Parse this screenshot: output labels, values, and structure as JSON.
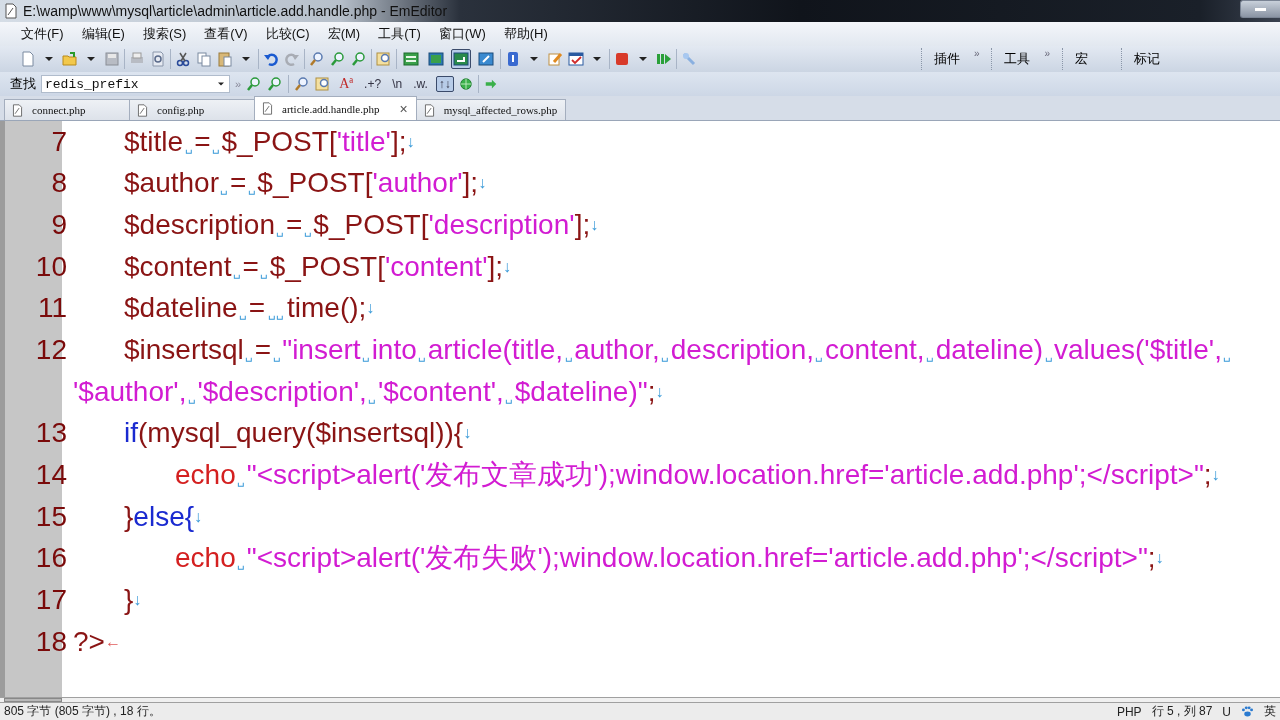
{
  "window": {
    "title": "E:\\wamp\\www\\mysql\\article\\admin\\article.add.handle.php - EmEditor"
  },
  "menu": [
    {
      "label": "文件(F)"
    },
    {
      "label": "编辑(E)"
    },
    {
      "label": "搜索(S)"
    },
    {
      "label": "查看(V)"
    },
    {
      "label": "比较(C)"
    },
    {
      "label": "宏(M)"
    },
    {
      "label": "工具(T)"
    },
    {
      "label": "窗口(W)"
    },
    {
      "label": "帮助(H)"
    }
  ],
  "toolbar": {
    "view_buttons": [
      {
        "selected": false
      },
      {
        "selected": false
      },
      {
        "selected": true
      },
      {
        "selected": false
      }
    ],
    "panels": [
      {
        "label": "插件",
        "more": "»"
      },
      {
        "label": "工具",
        "more": "»"
      },
      {
        "label": "宏"
      },
      {
        "label": "标记"
      }
    ]
  },
  "find_bar": {
    "label": "查找",
    "query": "redis_prefix",
    "more": "»",
    "options": [
      {
        "text": "Aª",
        "pressed": false
      },
      {
        "text": ".+?",
        "pressed": false
      },
      {
        "text": "\\n",
        "pressed": false
      },
      {
        "text": ".w.",
        "pressed": false
      },
      {
        "text": "↑↓",
        "pressed": true
      }
    ]
  },
  "tabs": [
    {
      "label": "connect.php",
      "selected": false
    },
    {
      "label": "config.php",
      "selected": false
    },
    {
      "label": "article.add.handle.php",
      "selected": true,
      "close": "×"
    },
    {
      "label": "mysql_affected_rows.php",
      "selected": false
    }
  ],
  "editor": {
    "lines": [
      {
        "number": "7",
        "rows": [
          {
            "tokens": [
              {
                "kind": "tab"
              },
              {
                "kind": "var",
                "text": "$title"
              },
              {
                "kind": "space",
                "text": "␣"
              },
              {
                "kind": "var",
                "text": "="
              },
              {
                "kind": "space",
                "text": "␣"
              },
              {
                "kind": "var",
                "text": "$_POST["
              },
              {
                "kind": "string",
                "text": "'title'"
              },
              {
                "kind": "var",
                "text": "];"
              },
              {
                "kind": "eol",
                "text": "↓"
              }
            ]
          }
        ]
      },
      {
        "number": "8",
        "rows": [
          {
            "tokens": [
              {
                "kind": "tab"
              },
              {
                "kind": "var",
                "text": "$author"
              },
              {
                "kind": "space",
                "text": "␣"
              },
              {
                "kind": "var",
                "text": "="
              },
              {
                "kind": "space",
                "text": "␣"
              },
              {
                "kind": "var",
                "text": "$_POST["
              },
              {
                "kind": "string",
                "text": "'author'"
              },
              {
                "kind": "var",
                "text": "];"
              },
              {
                "kind": "eol",
                "text": "↓"
              }
            ]
          }
        ]
      },
      {
        "number": "9",
        "rows": [
          {
            "tokens": [
              {
                "kind": "tab"
              },
              {
                "kind": "var",
                "text": "$description"
              },
              {
                "kind": "space",
                "text": "␣"
              },
              {
                "kind": "var",
                "text": "="
              },
              {
                "kind": "space",
                "text": "␣"
              },
              {
                "kind": "var",
                "text": "$_POST["
              },
              {
                "kind": "string",
                "text": "'description'"
              },
              {
                "kind": "var",
                "text": "];"
              },
              {
                "kind": "eol",
                "text": "↓"
              }
            ]
          }
        ]
      },
      {
        "number": "10",
        "rows": [
          {
            "tokens": [
              {
                "kind": "tab"
              },
              {
                "kind": "var",
                "text": "$content"
              },
              {
                "kind": "space",
                "text": "␣"
              },
              {
                "kind": "var",
                "text": "="
              },
              {
                "kind": "space",
                "text": "␣"
              },
              {
                "kind": "var",
                "text": "$_POST["
              },
              {
                "kind": "string",
                "text": "'content'"
              },
              {
                "kind": "var",
                "text": "];"
              },
              {
                "kind": "eol",
                "text": "↓"
              }
            ]
          }
        ]
      },
      {
        "number": "11",
        "rows": [
          {
            "tokens": [
              {
                "kind": "tab"
              },
              {
                "kind": "var",
                "text": "$dateline"
              },
              {
                "kind": "space",
                "text": "␣"
              },
              {
                "kind": "var",
                "text": "="
              },
              {
                "kind": "space",
                "text": "␣␣"
              },
              {
                "kind": "var",
                "text": "time();"
              },
              {
                "kind": "eol",
                "text": "↓"
              }
            ]
          }
        ]
      },
      {
        "number": "12",
        "rows": [
          {
            "tokens": [
              {
                "kind": "tab"
              },
              {
                "kind": "var",
                "text": "$insertsql"
              },
              {
                "kind": "space",
                "text": "␣"
              },
              {
                "kind": "var",
                "text": "="
              },
              {
                "kind": "space",
                "text": "␣"
              },
              {
                "kind": "string",
                "text": "\"insert"
              },
              {
                "kind": "space",
                "text": "␣"
              },
              {
                "kind": "string",
                "text": "into"
              },
              {
                "kind": "space",
                "text": "␣"
              },
              {
                "kind": "string",
                "text": "article(title,"
              },
              {
                "kind": "space",
                "text": "␣"
              },
              {
                "kind": "string",
                "text": "author,"
              },
              {
                "kind": "space",
                "text": "␣"
              },
              {
                "kind": "string",
                "text": "description,"
              },
              {
                "kind": "space",
                "text": "␣"
              },
              {
                "kind": "string",
                "text": "content,"
              },
              {
                "kind": "space",
                "text": "␣"
              },
              {
                "kind": "string",
                "text": "dateline)"
              },
              {
                "kind": "space",
                "text": "␣"
              },
              {
                "kind": "string",
                "text": "values('$title',"
              },
              {
                "kind": "space",
                "text": "␣"
              }
            ]
          },
          {
            "tokens": [
              {
                "kind": "string",
                "text": "'$author',"
              },
              {
                "kind": "space",
                "text": "␣"
              },
              {
                "kind": "string",
                "text": "'$description',"
              },
              {
                "kind": "space",
                "text": "␣"
              },
              {
                "kind": "string",
                "text": "'$content',"
              },
              {
                "kind": "space",
                "text": "␣"
              },
              {
                "kind": "string",
                "text": "$dateline)\""
              },
              {
                "kind": "var",
                "text": ";"
              },
              {
                "kind": "eol",
                "text": "↓"
              }
            ]
          }
        ]
      },
      {
        "number": "13",
        "rows": [
          {
            "tokens": [
              {
                "kind": "tab"
              },
              {
                "kind": "keyword",
                "text": "if"
              },
              {
                "kind": "var",
                "text": "(mysql_query($insertsql)){"
              },
              {
                "kind": "eol",
                "text": "↓"
              }
            ]
          }
        ]
      },
      {
        "number": "14",
        "rows": [
          {
            "tokens": [
              {
                "kind": "tab"
              },
              {
                "kind": "tab"
              },
              {
                "kind": "builtin",
                "text": "echo"
              },
              {
                "kind": "space",
                "text": "␣"
              },
              {
                "kind": "string",
                "text": "\"<script>alert('发布文章成功');window.location.href='article.add.php';</script>\""
              },
              {
                "kind": "var",
                "text": ";"
              },
              {
                "kind": "eol",
                "text": "↓"
              }
            ]
          }
        ]
      },
      {
        "number": "15",
        "rows": [
          {
            "tokens": [
              {
                "kind": "tab"
              },
              {
                "kind": "var",
                "text": "}"
              },
              {
                "kind": "keyword",
                "text": "else{"
              },
              {
                "kind": "eol",
                "text": "↓"
              }
            ]
          }
        ]
      },
      {
        "number": "16",
        "rows": [
          {
            "tokens": [
              {
                "kind": "tab"
              },
              {
                "kind": "tab"
              },
              {
                "kind": "builtin",
                "text": "echo"
              },
              {
                "kind": "space",
                "text": "␣"
              },
              {
                "kind": "string",
                "text": "\"<script>alert('发布失败');window.location.href='article.add.php';</script>\""
              },
              {
                "kind": "var",
                "text": ";"
              },
              {
                "kind": "eol",
                "text": "↓"
              }
            ]
          }
        ]
      },
      {
        "number": "17",
        "rows": [
          {
            "tokens": [
              {
                "kind": "tab"
              },
              {
                "kind": "var",
                "text": "}"
              },
              {
                "kind": "eol",
                "text": "↓"
              }
            ]
          }
        ]
      },
      {
        "number": "18",
        "rows": [
          {
            "tokens": [
              {
                "kind": "var",
                "text": "?>"
              },
              {
                "kind": "eof",
                "text": "←"
              }
            ]
          }
        ]
      }
    ]
  },
  "status_bar": {
    "summary": "805 字节 (805 字节) , 18 行。",
    "mode": "PHP",
    "position": "行 5 , 列 87",
    "encoding": "U",
    "ime": "英"
  }
}
